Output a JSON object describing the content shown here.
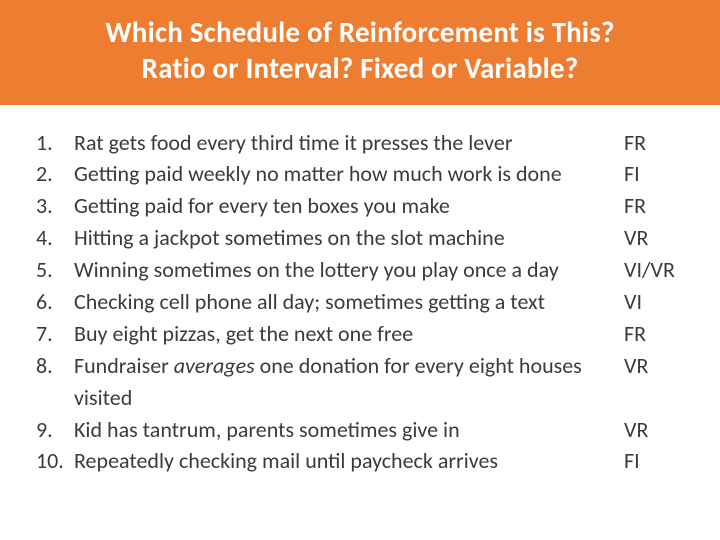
{
  "header": {
    "line1": "Which Schedule of Reinforcement is This?",
    "line2": "Ratio or Interval?  Fixed or Variable?"
  },
  "items": [
    {
      "num": "1.",
      "text": "Rat gets food every third time it presses the lever",
      "answer": "FR"
    },
    {
      "num": "2.",
      "text": "Getting paid weekly no matter how much work is done",
      "answer": "FI"
    },
    {
      "num": "3.",
      "text": "Getting paid for every ten boxes you make",
      "answer": "FR"
    },
    {
      "num": "4.",
      "text": "Hitting a jackpot sometimes on the slot machine",
      "answer": "VR"
    },
    {
      "num": "5.",
      "text": "Winning sometimes on the lottery you play once a day",
      "answer": "VI/VR"
    },
    {
      "num": "6.",
      "text": "Checking cell phone all day; sometimes getting a text",
      "answer": "VI"
    },
    {
      "num": "7.",
      "text": "Buy eight pizzas, get the next one free",
      "answer": "FR"
    },
    {
      "num": "8.",
      "text_pre": "Fundraiser ",
      "text_em": "averages",
      "text_post": " one donation for every eight houses",
      "wrap": "visited",
      "answer": "VR"
    },
    {
      "num": "9.",
      "text": "Kid has tantrum, parents sometimes give in",
      "answer": "VR"
    },
    {
      "num": "10.",
      "text": "Repeatedly checking mail until paycheck arrives",
      "answer": "FI"
    }
  ]
}
